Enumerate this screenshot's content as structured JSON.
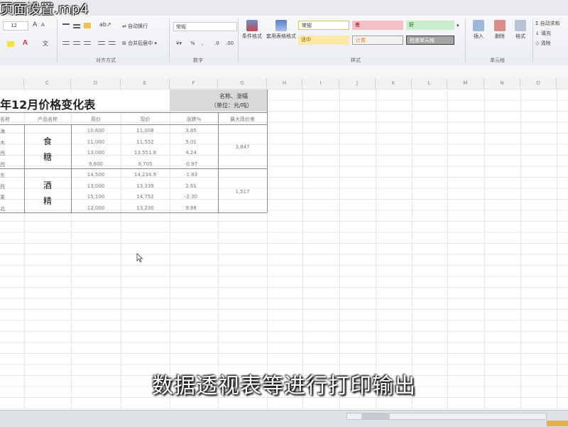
{
  "window": {
    "title": "页面设置.mp4"
  },
  "ribbon": {
    "font_size": "12",
    "wrap_text": "自动换行",
    "merge_center": "合并后居中",
    "number_format": "常规",
    "number_symbols": [
      "% ",
      ","
    ],
    "cond_format": "条件格式",
    "table_format": "套用表格格式",
    "styles": {
      "normal": "常规",
      "bad": "差",
      "good": "好",
      "neutral": "适中",
      "calc": "计算",
      "check": "检查单元格"
    },
    "cells_buttons": [
      "插入",
      "删除",
      "格式"
    ],
    "autosum": "自动求和",
    "fill": "填充",
    "clear": "清除",
    "group_labels": {
      "alignment": "对齐方式",
      "number": "数字",
      "styles": "样式",
      "cells": "单元格"
    }
  },
  "columns": [
    "C",
    "D",
    "E",
    "F",
    "G",
    "H",
    "I",
    "J",
    "K",
    "L",
    "M",
    "N",
    "O"
  ],
  "sheet": {
    "title": "年12月价格变化表",
    "note_line1": "名称、涨幅",
    "note_line2": "（单位：元/吨）",
    "headers": [
      "名称",
      "产品名称",
      "原价",
      "现价",
      "涨跌%",
      "最大现价差"
    ],
    "groups": [
      {
        "name_1": "食",
        "name_2": "糖",
        "max_diff": "3,847",
        "rows": [
          {
            "region": "海",
            "old": "10,600",
            "new": "11,008",
            "pct": "3.85"
          },
          {
            "region": "木",
            "old": "11,000",
            "new": "11,552",
            "pct": "5.01"
          },
          {
            "region": "西",
            "old": "13,000",
            "new": "13,551.8",
            "pct": "4.24"
          },
          {
            "region": "西",
            "old": "9,800",
            "new": "9,705",
            "pct": "-0.97"
          }
        ]
      },
      {
        "name_1": "酒",
        "name_2": "精",
        "max_diff": "1,517",
        "rows": [
          {
            "region": "东",
            "old": "14,500",
            "new": "14,234.9",
            "pct": "-1.83"
          },
          {
            "region": "西",
            "old": "13,000",
            "new": "13,339",
            "pct": "2.61"
          },
          {
            "region": "乘",
            "old": "15,100",
            "new": "14,752",
            "pct": "-2.30"
          },
          {
            "region": "北",
            "old": "12,000",
            "new": "13,230",
            "pct": "9.88"
          }
        ]
      }
    ]
  },
  "subtitle": "数据透视表等进行打印输出"
}
